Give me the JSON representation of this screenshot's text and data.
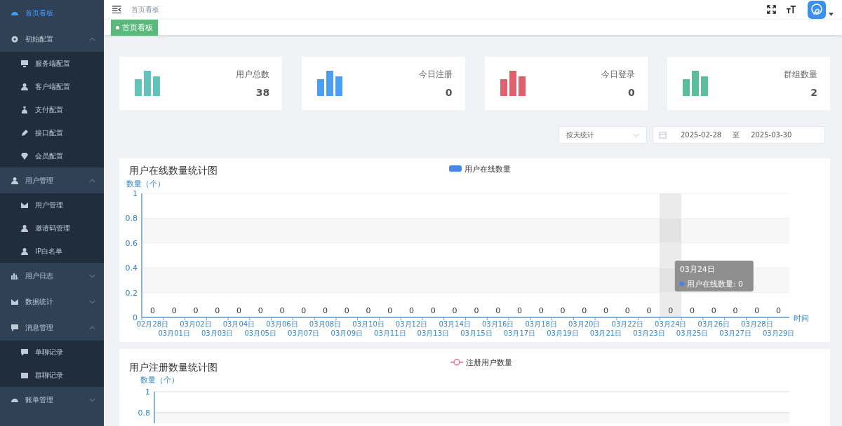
{
  "sidebar": {
    "items": [
      {
        "label": "首页看板",
        "selected": true
      },
      {
        "label": "初始配置",
        "selected": false,
        "expanded": true,
        "children": [
          {
            "label": "服务端配置",
            "selected": false
          },
          {
            "label": "客户端配置",
            "selected": false
          },
          {
            "label": "支付配置",
            "selected": false
          },
          {
            "label": "接口配置",
            "selected": false
          },
          {
            "label": "会员配置",
            "selected": false
          }
        ]
      },
      {
        "label": "用户管理",
        "selected": false,
        "expanded": true,
        "children": [
          {
            "label": "用户管理",
            "selected": false
          },
          {
            "label": "邀请码管理",
            "selected": false
          },
          {
            "label": "IP白名单",
            "selected": false
          }
        ]
      },
      {
        "label": "用户日志",
        "selected": false,
        "expanded": false
      },
      {
        "label": "数据统计",
        "selected": false,
        "expanded": false
      },
      {
        "label": "消息管理",
        "selected": false,
        "expanded": true,
        "children": [
          {
            "label": "单聊记录",
            "selected": false
          },
          {
            "label": "群聊记录",
            "selected": false
          }
        ]
      },
      {
        "label": "账单管理",
        "selected": false,
        "expanded": false
      }
    ]
  },
  "header": {
    "breadcrumb": "首页看板"
  },
  "tags": [
    {
      "label": "首页看板",
      "selected": true
    }
  ],
  "stats": [
    {
      "label": "用户总数",
      "value": "38",
      "color": "#62c3bb"
    },
    {
      "label": "今日注册",
      "value": "0",
      "color": "#4a9ff5"
    },
    {
      "label": "今日登录",
      "value": "0",
      "color": "#e0606e"
    },
    {
      "label": "群组数量",
      "value": "2",
      "color": "#5bbd9c"
    }
  ],
  "filters": {
    "mode": "按天统计",
    "start_date": "2025-02-28",
    "separator": "至",
    "end_date": "2025-03-30"
  },
  "online_chart": {
    "chart_data": {
      "type": "bar",
      "title": "用户在线数量统计图",
      "xlabel": "时间",
      "ylabel": "数量（个）",
      "categories": [
        "02月28日",
        "03月01日",
        "03月02日",
        "03月03日",
        "03月04日",
        "03月05日",
        "03月06日",
        "03月07日",
        "03月08日",
        "03月09日",
        "03月10日",
        "03月11日",
        "03月12日",
        "03月13日",
        "03月14日",
        "03月15日",
        "03月16日",
        "03月17日",
        "03月18日",
        "03月19日",
        "03月20日",
        "03月21日",
        "03月22日",
        "03月23日",
        "03月24日",
        "03月25日",
        "03月26日",
        "03月27日",
        "03月28日",
        "03月29日"
      ],
      "series": [
        {
          "name": "用户在线数量",
          "color": "#4a86e8",
          "values": [
            0,
            0,
            0,
            0,
            0,
            0,
            0,
            0,
            0,
            0,
            0,
            0,
            0,
            0,
            0,
            0,
            0,
            0,
            0,
            0,
            0,
            0,
            0,
            0,
            0,
            0,
            0,
            0,
            0,
            0
          ]
        }
      ],
      "ylim": [
        0,
        1
      ],
      "yticks": [
        0,
        0.2,
        0.4,
        0.6,
        0.8,
        1
      ],
      "grid": true,
      "data_labels": true
    },
    "tooltip": {
      "title": "03月24日",
      "text": "用户在线数量: 0"
    }
  },
  "register_chart": {
    "chart_data": {
      "type": "line",
      "title": "用户注册数量统计图",
      "ylabel": "数量（个）",
      "series": [
        {
          "name": "注册用户数量",
          "color": "#e8729a"
        }
      ],
      "ylim": [
        0.7,
        1
      ],
      "yticks": [
        0.8,
        1
      ],
      "grid": true
    }
  }
}
